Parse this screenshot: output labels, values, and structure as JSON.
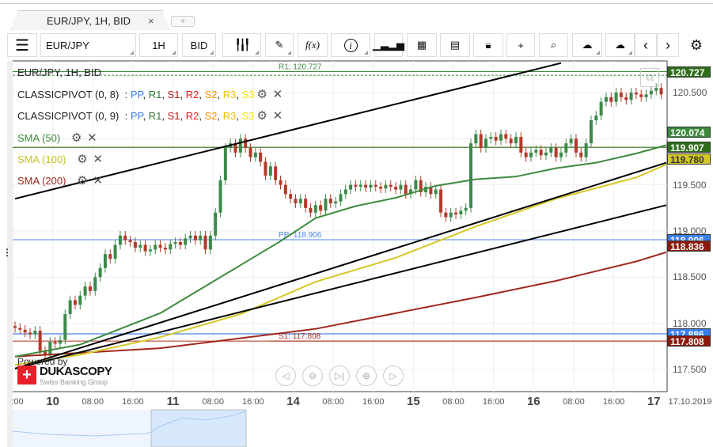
{
  "tab": {
    "title": "EUR/JPY, 1H, BID",
    "close": "×",
    "add": "+"
  },
  "toolbar": {
    "instrument": "EUR/JPY",
    "period": "1H",
    "side": "BID",
    "fx": "f(x)",
    "info": "i"
  },
  "legend": {
    "title": "EUR/JPY, 1H, BID",
    "pivots": [
      {
        "name": "CLASSICPIVOT (0, 8)"
      },
      {
        "name": "CLASSICPIVOT (0, 9)"
      }
    ],
    "pivot_keys": [
      {
        "t": "PP",
        "c": "#3a7ff0"
      },
      {
        "t": "R1",
        "c": "#2e7d32"
      },
      {
        "t": "S1",
        "c": "#b71c1c"
      },
      {
        "t": "R2",
        "c": "#f01818"
      },
      {
        "t": "S2",
        "c": "#ff8c00"
      },
      {
        "t": "R3",
        "c": "#f0c000"
      },
      {
        "t": "S3",
        "c": "#f5e600"
      }
    ],
    "sma": [
      {
        "name": "SMA (50)",
        "color": "#3c8a3c"
      },
      {
        "name": "SMA (100)",
        "color": "#c8c020"
      },
      {
        "name": "SMA (200)",
        "color": "#a0281c"
      }
    ]
  },
  "chart_data": {
    "type": "candlestick",
    "instrument": "EUR/JPY",
    "period": "1H",
    "ylim": [
      117.3,
      120.85
    ],
    "y_ticks": [
      "120.500",
      "119.500",
      "119.000",
      "118.500",
      "118.000",
      "117.500"
    ],
    "x_ticks": [
      {
        "bar": 0,
        "label": ":00"
      },
      {
        "bar": 8,
        "label": "10",
        "day": true
      },
      {
        "bar": 16,
        "label": "08:00"
      },
      {
        "bar": 24,
        "label": "16:00"
      },
      {
        "bar": 32,
        "label": "11",
        "day": true
      },
      {
        "bar": 40,
        "label": "08:00"
      },
      {
        "bar": 48,
        "label": "16:00"
      },
      {
        "bar": 56,
        "label": "14",
        "day": true
      },
      {
        "bar": 64,
        "label": "08:00"
      },
      {
        "bar": 72,
        "label": "16:00"
      },
      {
        "bar": 80,
        "label": "15",
        "day": true
      },
      {
        "bar": 88,
        "label": "08:00"
      },
      {
        "bar": 96,
        "label": "16:00"
      },
      {
        "bar": 104,
        "label": "16",
        "day": true
      },
      {
        "bar": 112,
        "label": "08:00"
      },
      {
        "bar": 120,
        "label": "16:00"
      },
      {
        "bar": 128,
        "label": "17",
        "day": true
      }
    ],
    "date_label": "17.10.2019",
    "closes": [
      117.95,
      117.93,
      117.9,
      117.88,
      117.92,
      117.7,
      117.65,
      117.8,
      117.78,
      117.82,
      118.1,
      118.25,
      118.2,
      118.3,
      118.4,
      118.35,
      118.5,
      118.6,
      118.75,
      118.7,
      118.85,
      118.95,
      118.9,
      118.88,
      118.82,
      118.85,
      118.78,
      118.8,
      118.85,
      118.82,
      118.8,
      118.86,
      118.88,
      118.85,
      118.92,
      118.95,
      118.9,
      118.95,
      118.8,
      118.95,
      119.2,
      119.55,
      119.9,
      119.95,
      119.85,
      120.0,
      119.9,
      119.8,
      119.85,
      119.75,
      119.6,
      119.7,
      119.55,
      119.5,
      119.4,
      119.35,
      119.3,
      119.35,
      119.25,
      119.2,
      119.28,
      119.22,
      119.35,
      119.3,
      119.32,
      119.4,
      119.45,
      119.5,
      119.48,
      119.5,
      119.47,
      119.5,
      119.48,
      119.46,
      119.5,
      119.48,
      119.45,
      119.5,
      119.4,
      119.45,
      119.55,
      119.42,
      119.48,
      119.4,
      119.45,
      119.2,
      119.15,
      119.2,
      119.18,
      119.22,
      119.25,
      119.95,
      120.05,
      119.9,
      120.0,
      120.02,
      119.98,
      120.05,
      120.0,
      119.95,
      120.02,
      119.85,
      119.8,
      119.85,
      119.88,
      119.82,
      119.85,
      119.9,
      119.8,
      119.85,
      119.95,
      120.0,
      119.85,
      119.8,
      119.95,
      120.2,
      120.25,
      120.4,
      120.45,
      120.4,
      120.5,
      120.45,
      120.42,
      120.5,
      120.48,
      120.45,
      120.48,
      120.52,
      120.55,
      120.48
    ],
    "sma50": [
      [
        0,
        117.64
      ],
      [
        13,
        117.77
      ],
      [
        29,
        118.11
      ],
      [
        45,
        118.63
      ],
      [
        53,
        118.89
      ],
      [
        60,
        119.14
      ],
      [
        68,
        119.27
      ],
      [
        76,
        119.36
      ],
      [
        84,
        119.49
      ],
      [
        92,
        119.56
      ],
      [
        100,
        119.59
      ],
      [
        108,
        119.68
      ],
      [
        116,
        119.74
      ],
      [
        124,
        119.84
      ],
      [
        130,
        119.93
      ]
    ],
    "sma100": [
      [
        0,
        117.55
      ],
      [
        13,
        117.66
      ],
      [
        29,
        117.85
      ],
      [
        45,
        118.1
      ],
      [
        60,
        118.45
      ],
      [
        76,
        118.71
      ],
      [
        92,
        119.05
      ],
      [
        108,
        119.35
      ],
      [
        124,
        119.58
      ],
      [
        130,
        119.72
      ]
    ],
    "sma200": [
      [
        0,
        117.64
      ],
      [
        29,
        117.73
      ],
      [
        60,
        117.94
      ],
      [
        76,
        118.11
      ],
      [
        92,
        118.28
      ],
      [
        108,
        118.46
      ],
      [
        124,
        118.67
      ],
      [
        130,
        118.77
      ]
    ],
    "trendlines": [
      [
        [
          0,
          119.35
        ],
        [
          109,
          120.82
        ]
      ],
      [
        [
          0,
          117.51
        ],
        [
          130,
          119.74
        ]
      ],
      [
        [
          0,
          117.51
        ],
        [
          130,
          119.28
        ]
      ]
    ],
    "levels": [
      {
        "label": "R1: 120.727",
        "value": 120.727,
        "color": "#3c8a3c"
      },
      {
        "label": "",
        "value": 120.688,
        "color": "#3c8a3c",
        "dashed": true
      },
      {
        "label": "",
        "value": 119.907,
        "color": "#2e6e1a"
      },
      {
        "label": "PP: 118.906",
        "value": 118.906,
        "color": "#4a86e8"
      },
      {
        "label": "",
        "value": 117.886,
        "color": "#4a86e8"
      },
      {
        "label": "S1: 117.808",
        "value": 117.808,
        "color": "#b03020"
      }
    ],
    "price_labels": [
      {
        "text": "120.727",
        "value": 120.727,
        "bg": "#2e6e1a"
      },
      {
        "text": "120.074",
        "value": 120.074,
        "bg": "#3c8a3c"
      },
      {
        "text": "119.907",
        "value": 119.907,
        "bg": "#2e6e1a"
      },
      {
        "text": "119.780",
        "value": 119.78,
        "bg": "#d4c825",
        "fg": "#333"
      },
      {
        "text": "118.906",
        "value": 118.906,
        "bg": "#3a7ff0"
      },
      {
        "text": "118.836",
        "value": 118.836,
        "bg": "#8b1a0a"
      },
      {
        "text": "117.886",
        "value": 117.886,
        "bg": "#3a7ff0"
      },
      {
        "text": "117.808",
        "value": 117.808,
        "bg": "#8b1a0a"
      }
    ]
  },
  "branding": {
    "powered": "Powered by",
    "name": "DUKASCOPY",
    "sub": "Swiss Banking Group"
  },
  "colors": {
    "up": "#3c8a4a",
    "down": "#b23a2a"
  }
}
